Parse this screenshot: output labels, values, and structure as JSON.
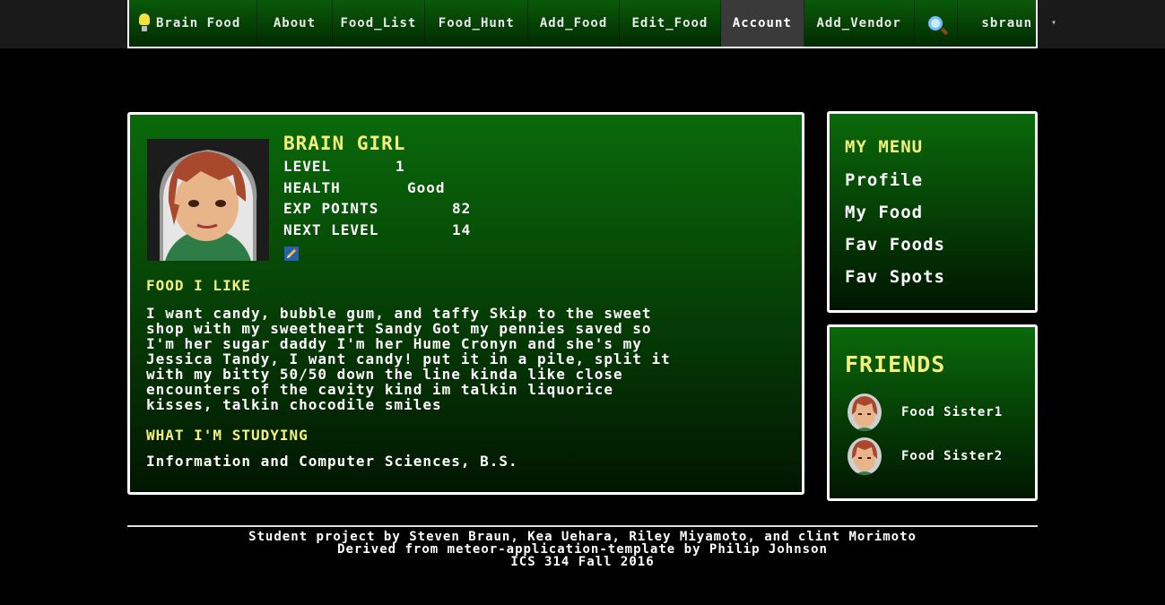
{
  "nav": {
    "brand": "Brain Food",
    "items": [
      "About",
      "Food_List",
      "Food_Hunt",
      "Add_Food",
      "Edit_Food",
      "Account",
      "Add_Vendor"
    ],
    "active": "Account",
    "search_icon": "magnifier-icon",
    "user": "sbraun",
    "caret_icon": "caret-down-icon"
  },
  "profile": {
    "name": "BRAIN GIRL",
    "stats": [
      {
        "label": "LEVEL",
        "value": "1"
      },
      {
        "label": "HEALTH",
        "value": "Good"
      },
      {
        "label": "EXP POINTS",
        "value": "82"
      },
      {
        "label": "NEXT LEVEL",
        "value": "14"
      }
    ],
    "edit_icon": "pencil-edit-icon",
    "food_heading": "FOOD I LIKE",
    "food_lines": [
      "I want candy, bubble gum, and taffy Skip to the sweet",
      "shop with my sweetheart Sandy Got my pennies saved so",
      "I'm her sugar daddy I'm her Hume Cronyn and she's my",
      "Jessica Tandy, I want candy! put it in a pile, split it",
      "with my bitty 50/50 down the line kinda like close",
      "encounters of the cavity kind im talkin liquorice",
      "kisses, talkin chocodile smiles"
    ],
    "study_heading": "WHAT I'M STUDYING",
    "study": "Information and Computer Sciences, B.S."
  },
  "menu": {
    "title": "MY MENU",
    "items": [
      "Profile",
      "My Food",
      "Fav Foods",
      "Fav Spots"
    ]
  },
  "friends": {
    "title": "FRIENDS",
    "items": [
      "Food Sister1",
      "Food Sister2"
    ]
  },
  "footer": {
    "lines": [
      "Student project by Steven Braun, Kea Uehara, Riley Miyamoto, and clint Morimoto",
      "Derived from meteor-application-template by Philip Johnson",
      "ICS 314 Fall 2016"
    ]
  },
  "colors": {
    "accent_yellow": "#f5f07a",
    "panel_top": "#0a6a0a",
    "panel_bottom": "#011601"
  }
}
